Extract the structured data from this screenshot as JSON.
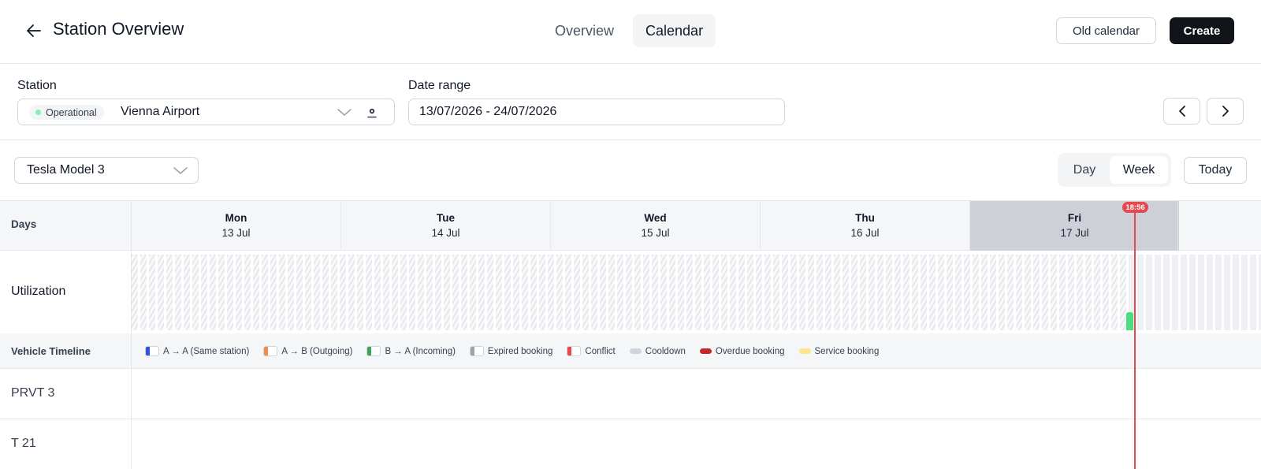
{
  "header": {
    "title": "Station Overview",
    "tabs": [
      {
        "label": "Overview",
        "active": false
      },
      {
        "label": "Calendar",
        "active": true
      }
    ],
    "old_calendar_label": "Old calendar",
    "create_label": "Create"
  },
  "filters": {
    "station_label": "Station",
    "station_status": "Operational",
    "station_value": "Vienna Airport",
    "date_range_label": "Date range",
    "date_range_value": "13/07/2026 - 24/07/2026"
  },
  "toolbar": {
    "vehicle_model": "Tesla Model 3",
    "view_options": [
      {
        "label": "Day",
        "active": false
      },
      {
        "label": "Week",
        "active": true
      }
    ],
    "today_label": "Today"
  },
  "calendar": {
    "days_label": "Days",
    "days": [
      {
        "name": "Mon",
        "date": "13 Jul",
        "today": false
      },
      {
        "name": "Tue",
        "date": "14 Jul",
        "today": false
      },
      {
        "name": "Wed",
        "date": "15 Jul",
        "today": false
      },
      {
        "name": "Thu",
        "date": "16 Jul",
        "today": false
      },
      {
        "name": "Fri",
        "date": "17 Jul",
        "today": true
      }
    ],
    "current_time": "18:56",
    "utilization_label": "Utilization",
    "utilization_current_level": 0.24,
    "vehicle_timeline_label": "Vehicle Timeline",
    "legend": [
      {
        "label": "A → A (Same station)",
        "color": "#2f55d4",
        "kind": "box"
      },
      {
        "label": "A → B (Outgoing)",
        "color": "#f28b4b",
        "kind": "box"
      },
      {
        "label": "B → A (Incoming)",
        "color": "#3aa757",
        "kind": "box"
      },
      {
        "label": "Expired booking",
        "color": "#9ca3af",
        "kind": "box"
      },
      {
        "label": "Conflict",
        "color": "#e5484d",
        "kind": "box"
      },
      {
        "label": "Cooldown",
        "color": "#d1d5db",
        "kind": "bar"
      },
      {
        "label": "Overdue booking",
        "color": "#c62828",
        "kind": "bar"
      },
      {
        "label": "Service booking",
        "color": "#fde68a",
        "kind": "bar"
      }
    ],
    "vehicles": [
      "PRVT 3",
      "T 21"
    ]
  },
  "colors": {
    "accent_dark": "#111418",
    "now_line": "#e5484d",
    "status_operational": "#86efac",
    "utilization_bar": "#4ade80"
  }
}
